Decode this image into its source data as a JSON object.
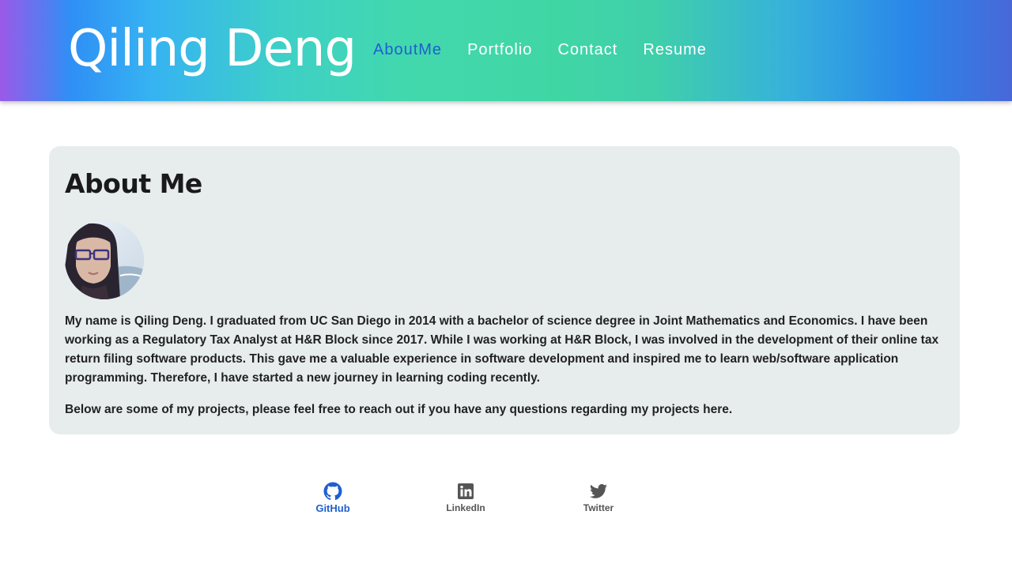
{
  "header": {
    "brand": "Qiling Deng",
    "nav": [
      {
        "label": "AboutMe",
        "active": true
      },
      {
        "label": "Portfolio",
        "active": false
      },
      {
        "label": "Contact",
        "active": false
      },
      {
        "label": "Resume",
        "active": false
      }
    ]
  },
  "about": {
    "title": "About Me",
    "paragraph1": "My name is Qiling Deng. I graduated from UC San Diego in 2014 with a bachelor of science degree in Joint Mathematics and Economics. I have been working as a Regulatory Tax Analyst at H&R Block since 2017. While I was working at H&R Block, I was involved in the development of their online tax return filing software products. This gave me a valuable experience in software development and inspired me to learn web/software application programming. Therefore, I have started a new journey in learning coding recently.",
    "paragraph2": "Below are some of my projects, please feel free to reach out if you have any questions regarding my projects here."
  },
  "social": [
    {
      "label": "GitHub",
      "icon": "github-icon",
      "active": true
    },
    {
      "label": "LinkedIn",
      "icon": "linkedin-icon",
      "active": false
    },
    {
      "label": "Twitter",
      "icon": "twitter-icon",
      "active": false
    }
  ],
  "colors": {
    "accent": "#1f5fd0",
    "card_bg": "#e7eded"
  }
}
